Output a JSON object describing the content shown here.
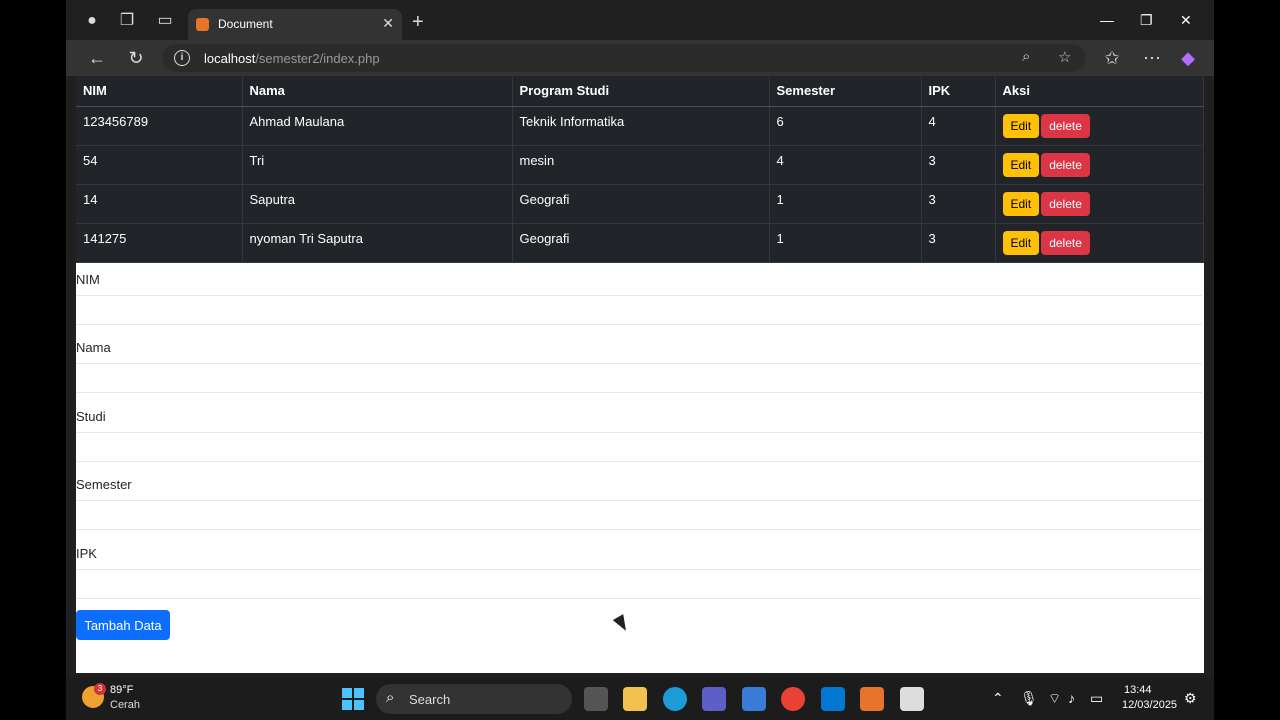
{
  "browser": {
    "tab_title": "Document",
    "url_host": "localhost",
    "url_path": "/semester2/index.php"
  },
  "table": {
    "headers": [
      "NIM",
      "Nama",
      "Program Studi",
      "Semester",
      "IPK",
      "Aksi"
    ],
    "rows": [
      {
        "nim": "123456789",
        "nama": "Ahmad Maulana",
        "studi": "Teknik Informatika",
        "semester": "6",
        "ipk": "4"
      },
      {
        "nim": "54",
        "nama": "Tri",
        "studi": "mesin",
        "semester": "4",
        "ipk": "3"
      },
      {
        "nim": "14",
        "nama": "Saputra",
        "studi": "Geografi",
        "semester": "1",
        "ipk": "3"
      },
      {
        "nim": "141275",
        "nama": "nyoman Tri Saputra",
        "studi": "Geografi",
        "semester": "1",
        "ipk": "3"
      }
    ],
    "edit_label": "Edit",
    "delete_label": "delete"
  },
  "form": {
    "labels": [
      "NIM",
      "Nama",
      "Studi",
      "Semester",
      "IPK"
    ],
    "values": [
      "",
      "",
      "",
      "",
      ""
    ],
    "submit_label": "Tambah Data"
  },
  "taskbar": {
    "weather_temp": "89°F",
    "weather_desc": "Cerah",
    "weather_badge": "3",
    "search_label": "Search",
    "time": "13:44",
    "date": "12/03/2025"
  },
  "colors": {
    "table_bg": "#212529",
    "edit": "#ffc107",
    "delete": "#dc3545",
    "primary": "#0d6efd"
  }
}
